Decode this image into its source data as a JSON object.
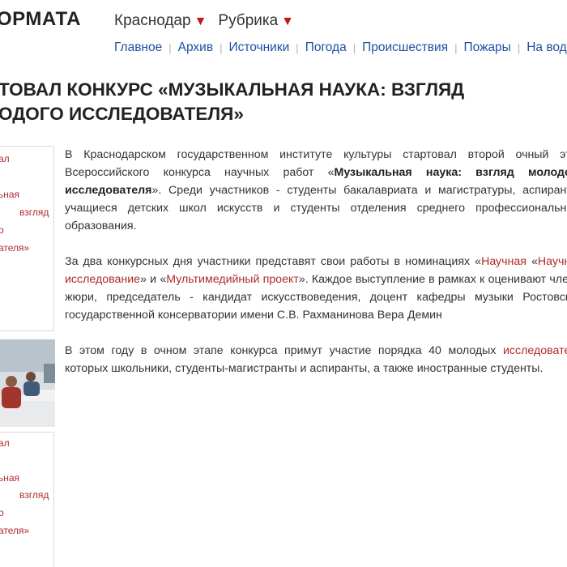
{
  "site": {
    "logo_text": "ОРМАТА"
  },
  "header": {
    "dropdowns": [
      {
        "label": "Краснодар"
      },
      {
        "label": "Рубрика"
      }
    ],
    "nav": [
      "Главное",
      "Архив",
      "Источники",
      "Погода",
      "Происшествия",
      "Пожары",
      "На вод"
    ]
  },
  "article": {
    "title_line1": "ТОВАЛ КОНКУРС «МУЗЫКАЛЬНАЯ НАУКА: ВЗГЛЯД",
    "title_line2": "ОДОГО ИССЛЕДОВАТЕЛЯ»",
    "p1_a": "В Краснодарском государственном институте культуры стартовал второй очный этап Всероссийского конкурса научных работ «",
    "p1_bold": "Музыкальная наука: взгляд молодого исследователя",
    "p1_b": "». Среди участников - студенты бакалавриата и магистратуры, аспиранты, учащиеся детских школ искусств и студенты отделения среднего профессионального образования.",
    "p2_a": "За два конкурсных дня участники представят свои работы в номинациях «",
    "p2_link1": "Научная",
    "p2_b": " «",
    "p2_link2": "Научное исследование",
    "p2_c": "» и «",
    "p2_link3": "Мультимедийный проект",
    "p2_d": "». Каждое выступление в рамках к оценивают члены жюри, председатель - кандидат искусствоведения, доцент кафедры музыки Ростовской государственной консерватории имени С.В. Рахманинова Вера Демин",
    "p3_a": "В этом году в очном этапе конкурса примут участие порядка 40 молодых ",
    "p3_link": "исследователе",
    "p3_b": " которых школьники, студенты-магистранты и аспиранты, а также иностранные студенты."
  },
  "sidebar": {
    "card1": [
      "ал",
      "ьная",
      "взгляд",
      "о",
      "ателя»"
    ],
    "card2": [
      "ал",
      "ьная",
      "взгляд",
      "о",
      "ателя»"
    ]
  },
  "colors": {
    "accent_red": "#c4161c",
    "link_blue": "#1f4fa3",
    "link_red": "#b02a2a"
  }
}
